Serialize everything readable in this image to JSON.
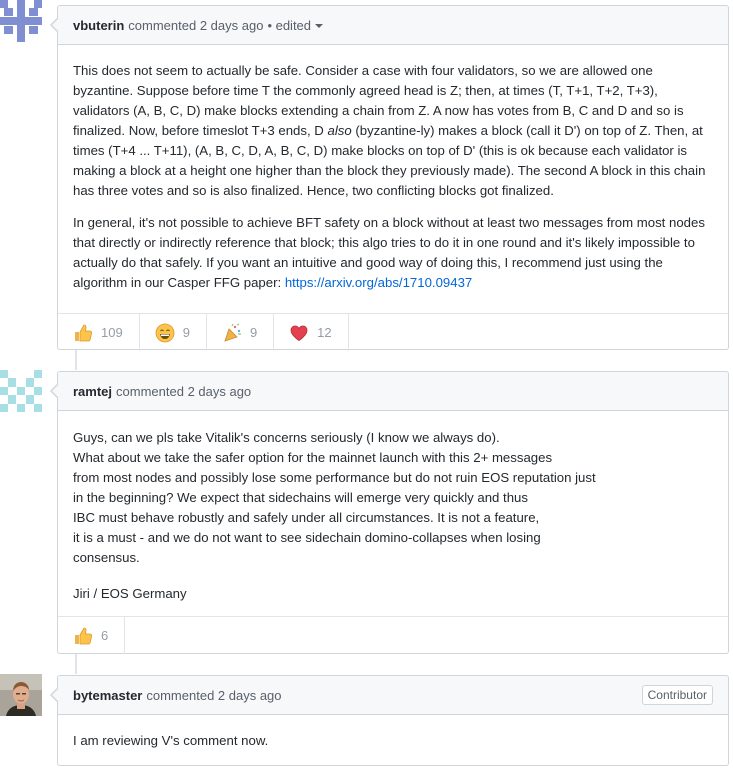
{
  "comments": [
    {
      "author": "vbuterin",
      "meta": "commented 2 days ago",
      "edited": "• edited",
      "paragraphs": [
        {
          "pre": "This does not seem to actually be safe. Consider a case with four validators, so we are allowed one byzantine. Suppose before time T the commonly agreed head is Z; then, at times (T, T+1, T+2, T+3), validators (A, B, C, D) make blocks extending a chain from Z. A now has votes from B, C and D and so is finalized. Now, before timeslot T+3 ends, D ",
          "em": "also",
          "post": " (byzantine-ly) makes a block (call it D') on top of Z. Then, at times (T+4 ... T+11), (A, B, C, D, A, B, C, D) make blocks on top of D' (this is ok because each validator is making a block at a height one higher than the block they previously made). The second A block in this chain has three votes and so is also finalized. Hence, two conflicting blocks got finalized."
        },
        {
          "pre": "In general, it's not possible to achieve BFT safety on a block without at least two messages from most nodes that directly or indirectly reference that block; this algo tries to do it in one round and it's likely impossible to actually do that safely. If you want an intuitive and good way of doing this, I recommend just using the algorithm in our Casper FFG paper: ",
          "link": "https://arxiv.org/abs/1710.09437"
        }
      ],
      "reactions": {
        "thumbs_up": "109",
        "laugh": "9",
        "hooray": "9",
        "heart": "12"
      }
    },
    {
      "author": "ramtej",
      "meta": "commented 2 days ago",
      "lines": [
        "Guys, can we pls take Vitalik's concerns seriously (I know we always do).",
        "What about we take the safer option for the mainnet launch with this 2+ messages",
        "from most nodes and possibly lose some performance but do not ruin EOS reputation just",
        "in the beginning? We expect that sidechains will emerge very quickly and thus",
        "IBC must behave robustly and safely under all circumstances. It is not a feature,",
        "it is a must - and we do not want to see sidechain domino-collapses when losing",
        "consensus."
      ],
      "signature": "Jiri / EOS Germany",
      "reactions": {
        "thumbs_up": "6"
      }
    },
    {
      "author": "bytemaster",
      "meta": "commented 2 days ago",
      "badge": "Contributor",
      "body": "I am reviewing V's comment now."
    }
  ],
  "colors": {
    "link": "#0366d6",
    "header_bg": "#f6f8fa",
    "border": "#d1d5da",
    "avatar1": "#7f8fd1",
    "avatar2": "#a8dfe5"
  }
}
